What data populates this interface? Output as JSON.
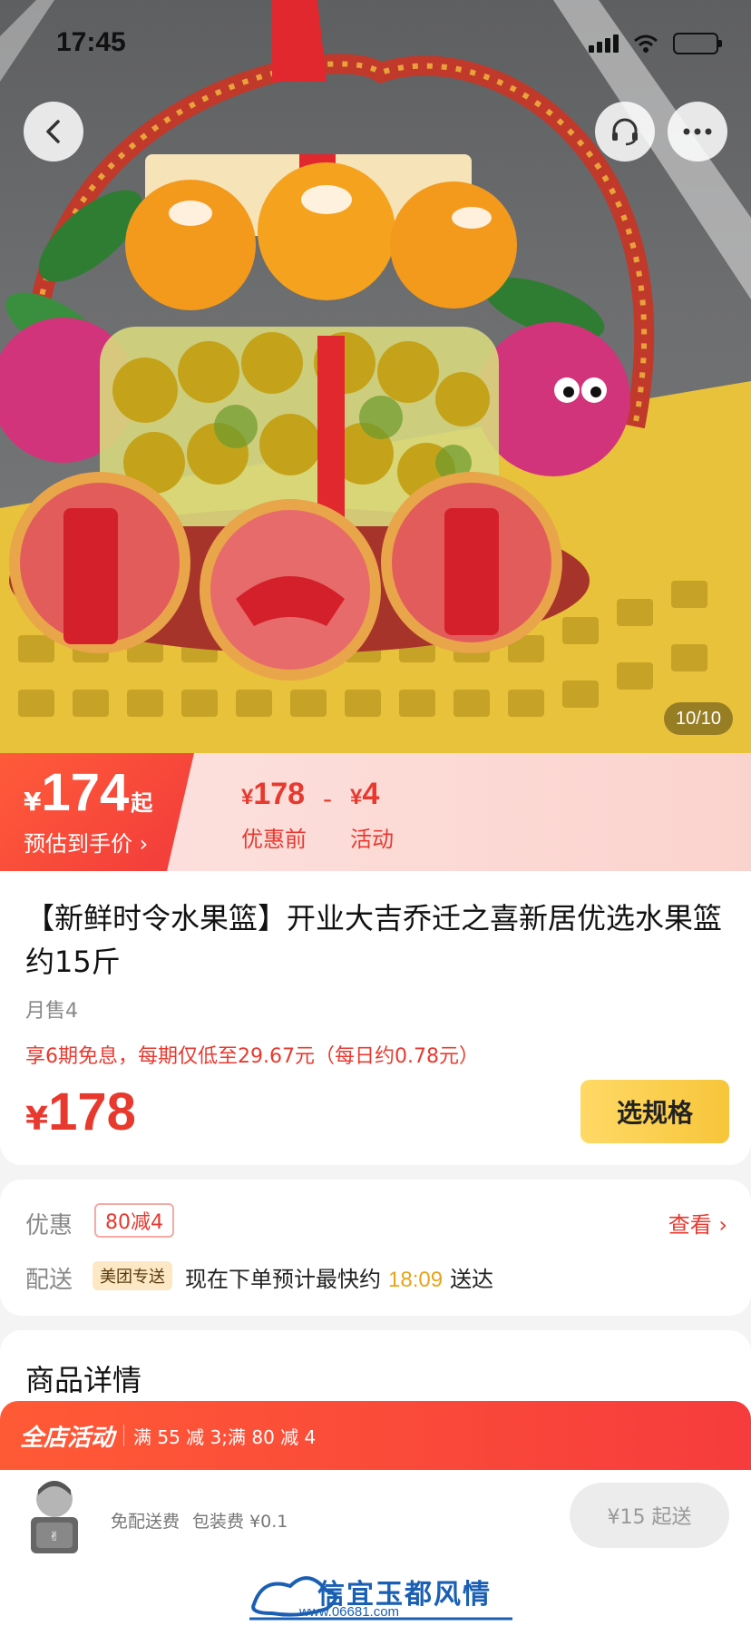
{
  "status_bar": {
    "time": "17:45"
  },
  "hero": {
    "image_counter": "10/10"
  },
  "price_banner": {
    "est_yen": "¥",
    "est_price": "174",
    "est_suffix": "起",
    "est_label": "预估到手价 ›",
    "orig_yen": "¥",
    "orig_price": "178",
    "orig_label": "优惠前",
    "minus": "-",
    "discount_yen": "¥",
    "discount_price": "4",
    "discount_label": "活动"
  },
  "product": {
    "title": "【新鲜时令水果篮】开业大吉乔迁之喜新居优选水果篮约15斤",
    "sold": "月售4",
    "installment": "享6期免息，每期仅低至29.67元（每日约0.78元）",
    "price_yen": "¥",
    "price": "178",
    "spec_button": "选规格"
  },
  "info": {
    "discount_label": "优惠",
    "coupon": "80减4",
    "view_link": "查看 ›",
    "delivery_label": "配送",
    "delivery_tag": "美团专送",
    "delivery_prefix": "现在下单预计最快约",
    "delivery_time": "18:09",
    "delivery_suffix": "送达"
  },
  "detail": {
    "title": "商品详情"
  },
  "activity": {
    "label": "全店活动",
    "text": "满 55 减 3;满 80 减 4"
  },
  "bottom": {
    "free_delivery": "免配送费",
    "packing_fee": "包装费 ¥0.1",
    "min_order": "¥15 起送",
    "watermark_text": "信宜玉都风情",
    "watermark_url": "www.06681.com"
  }
}
